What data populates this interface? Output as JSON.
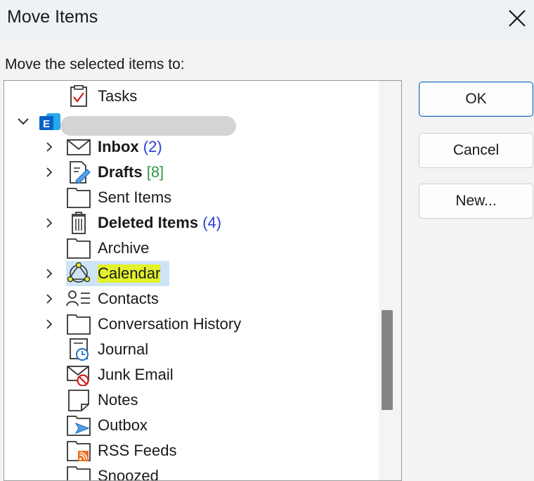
{
  "dialog": {
    "title": "Move Items",
    "prompt": "Move the selected items to:"
  },
  "tree": {
    "items": [
      {
        "label": "Tasks",
        "icon": "tasks-icon"
      },
      {
        "label": "",
        "icon": "exchange-account-icon"
      },
      {
        "label": "Inbox",
        "count": "(2)",
        "icon": "envelope-icon"
      },
      {
        "label": "Drafts",
        "count": "[8]",
        "icon": "drafts-icon"
      },
      {
        "label": "Sent Items",
        "icon": "folder-icon"
      },
      {
        "label": "Deleted Items",
        "count": "(4)",
        "icon": "trash-icon"
      },
      {
        "label": "Archive",
        "icon": "folder-icon"
      },
      {
        "label": "Calendar",
        "icon": "calendar-icon"
      },
      {
        "label": "Contacts",
        "icon": "contacts-icon"
      },
      {
        "label": "Conversation History",
        "icon": "folder-icon"
      },
      {
        "label": "Journal",
        "icon": "journal-icon"
      },
      {
        "label": "Junk Email",
        "icon": "junk-icon"
      },
      {
        "label": "Notes",
        "icon": "notes-icon"
      },
      {
        "label": "Outbox",
        "icon": "outbox-icon"
      },
      {
        "label": "RSS Feeds",
        "icon": "rss-icon"
      },
      {
        "label": "Snoozed",
        "icon": "folder-icon"
      }
    ]
  },
  "buttons": {
    "ok": "OK",
    "cancel": "Cancel",
    "new": "New..."
  },
  "colors": {
    "highlight": "#e2f22b",
    "selection": "#cde4f7",
    "count_blue": "#2b3fd6",
    "count_green": "#2f9a40"
  }
}
